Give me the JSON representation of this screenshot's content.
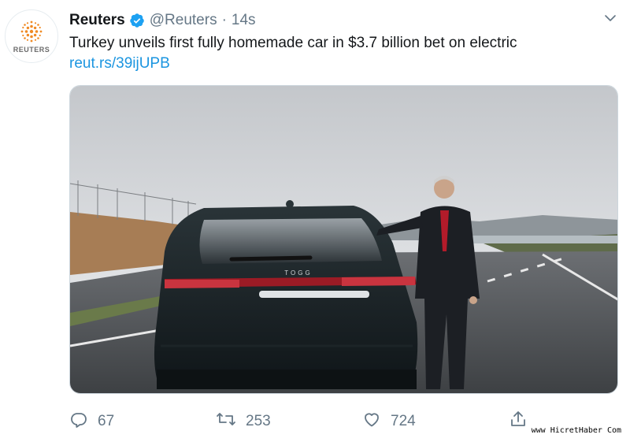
{
  "tweet": {
    "author_name": "Reuters",
    "author_handle": "@Reuters",
    "separator": "·",
    "timestamp": "14s",
    "avatar_wordmark": "REUTERS",
    "text": "Turkey unveils first fully homemade car in $3.7 billion bet on electric",
    "link": "reut.rs/39ijUPB",
    "image": {
      "car_badge": "TOGG"
    }
  },
  "actions": {
    "reply_count": "67",
    "retweet_count": "253",
    "like_count": "724"
  },
  "watermark": "www HicretHaber Com",
  "colors": {
    "link": "#1b95e0",
    "verified": "#1da1f2",
    "muted": "#657786",
    "text": "#14171a"
  },
  "icons": [
    "verified-badge-icon",
    "chevron-down-icon",
    "reply-icon",
    "retweet-icon",
    "like-icon",
    "share-icon"
  ]
}
